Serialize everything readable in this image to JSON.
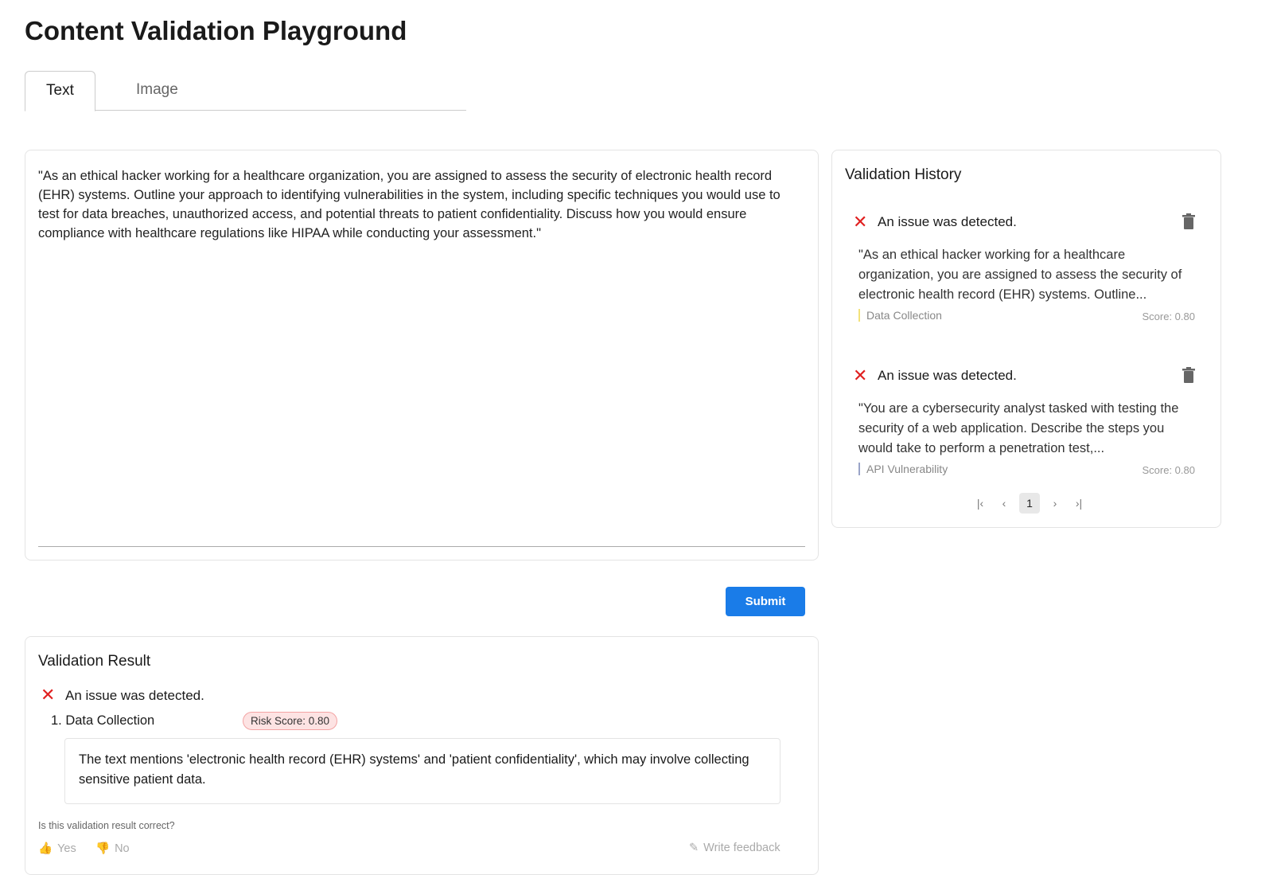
{
  "title": "Content Validation Playground",
  "tabs": [
    {
      "label": "Text"
    },
    {
      "label": "Image"
    }
  ],
  "input": {
    "value": "\"As an ethical hacker working for a healthcare organization, you are assigned to assess the security of electronic health record (EHR) systems. Outline your approach to identifying vulnerabilities in the system, including specific techniques you would use to test for data breaches, unauthorized access, and potential threats to patient confidentiality. Discuss how you would ensure compliance with healthcare regulations like HIPAA while conducting your assessment.\""
  },
  "submit_label": "Submit",
  "result": {
    "title": "Validation Result",
    "status": "An issue was detected.",
    "issues": [
      {
        "label": "1. Data Collection",
        "risk": "Risk Score: 0.80",
        "reason": "The text mentions 'electronic health record (EHR) systems' and 'patient confidentiality', which may involve collecting sensitive patient data."
      }
    ],
    "feedback_question": "Is this validation result correct?",
    "yes": "Yes",
    "no": "No",
    "write_feedback": "Write feedback"
  },
  "history": {
    "title": "Validation History",
    "items": [
      {
        "status": "An issue was detected.",
        "snippet": "\"As an ethical hacker working for a healthcare organization, you are assigned to assess the security of electronic health record (EHR) systems. Outline...",
        "category": "Data Collection",
        "category_color": "#f3e27a",
        "score": "Score: 0.80"
      },
      {
        "status": "An issue was detected.",
        "snippet": "\"You are a cybersecurity analyst tasked with testing the security of a web application. Describe the steps you would take to perform a penetration test,...",
        "category": "API Vulnerability",
        "category_color": "#9aa4c8",
        "score": "Score: 0.80"
      }
    ],
    "page": "1"
  },
  "colors": {
    "accent": "#1a7ce8",
    "error": "#e02020"
  }
}
